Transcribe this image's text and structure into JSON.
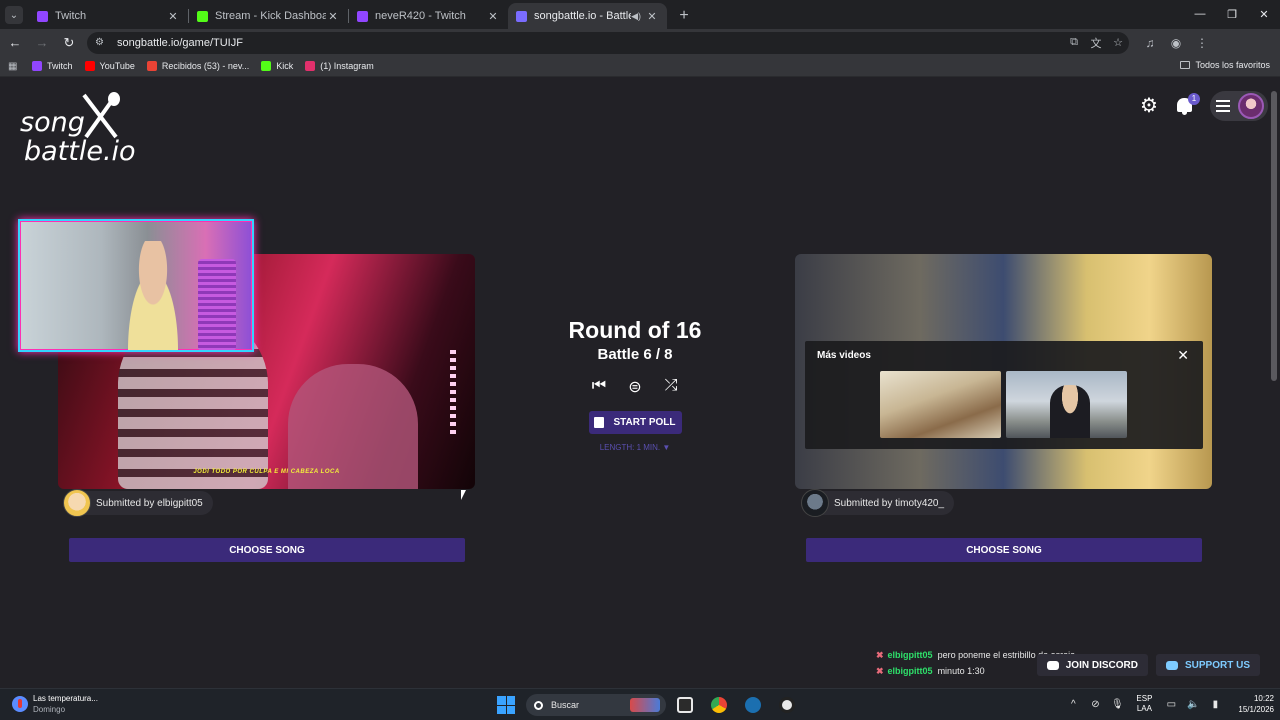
{
  "browser": {
    "tabs": [
      {
        "title": "Twitch",
        "favicon_color": "#9146ff",
        "active": false
      },
      {
        "title": "Stream - Kick Dashboard",
        "favicon_color": "#53fc18",
        "active": false
      },
      {
        "title": "neveR420 - Twitch",
        "favicon_color": "#9146ff",
        "active": false
      },
      {
        "title": "songbattle.io - Battle Songs",
        "favicon_color": "#7a6cff",
        "active": true,
        "audio_icon": "speaker-icon"
      }
    ],
    "url": "songbattle.io/game/TUIJF",
    "bookmarks": [
      {
        "label": "Twitch",
        "icon_color": "#9146ff"
      },
      {
        "label": "YouTube",
        "icon_color": "#ff0000"
      },
      {
        "label": "Recibidos (53) - nev...",
        "icon_color": "#ea4335"
      },
      {
        "label": "Kick",
        "icon_color": "#53fc18"
      },
      {
        "label": "(1) Instagram",
        "icon_color": "#e1306c"
      }
    ],
    "all_bookmarks_label": "Todos los favoritos"
  },
  "site": {
    "logo_line1": "song",
    "logo_line2": "battle.io",
    "notification_count": "1",
    "accent_color": "#3b2a7a"
  },
  "game": {
    "round": "Round of 16",
    "battle": "Battle 6 / 8",
    "start_poll_label": "START POLL",
    "length_label": "LENGTH: 1 MIN. ▼",
    "left": {
      "submitted_by": "Submitted by elbigpitt05",
      "choose_label": "CHOOSE SONG",
      "subtitle": "JODI TODO POR CULPA E MI CABEZA LOCA"
    },
    "right": {
      "submitted_by": "Submitted by timoty420_",
      "choose_label": "CHOOSE SONG",
      "more_videos_title": "Más videos"
    }
  },
  "chat": [
    {
      "user": "elbigpitt05",
      "message": "pero poneme el estribillo de asreje"
    },
    {
      "user": "elbigpitt05",
      "message": "minuto 1:30"
    }
  ],
  "footer_buttons": {
    "discord": "JOIN DISCORD",
    "support": "SUPPORT US"
  },
  "taskbar": {
    "weather_title": "Las temperatura...",
    "weather_sub": "Domingo",
    "search_placeholder": "Buscar",
    "lang_line1": "ESP",
    "lang_line2": "LAA",
    "time": "10:22",
    "date": "15/1/2026"
  }
}
